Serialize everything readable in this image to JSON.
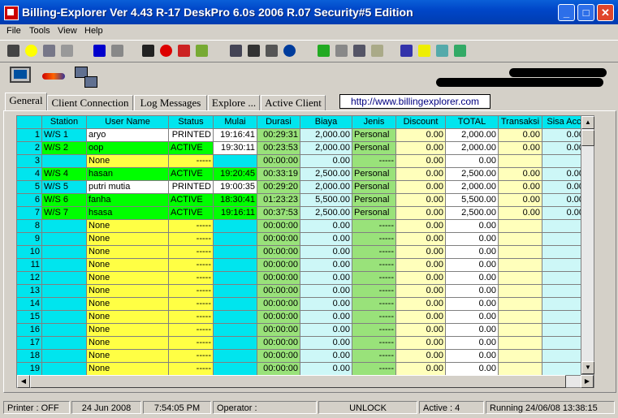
{
  "window": {
    "title": "Billing-Explorer Ver 4.43 R-17 DeskPro 6.0s 2006 R.07 Security#5 Edition"
  },
  "menu": [
    "File",
    "Tools",
    "View",
    "Help"
  ],
  "toolbar_icons": [
    "binoculars-icon",
    "smiley-icon",
    "lock-icon",
    "key-icon",
    "monitor-icon",
    "clock-run-icon",
    "eye-icon",
    "stop-icon",
    "timer-icon",
    "hand-icon",
    "network-icon",
    "users-icon",
    "printer-icon",
    "info-icon",
    "connect-icon",
    "plug-icon",
    "document-icon",
    "notepad-icon",
    "login-icon",
    "flash-icon",
    "database-icon",
    "refresh-icon"
  ],
  "icon_row": [
    "computer-icon",
    "car-icon",
    "network-computers-icon"
  ],
  "tabs": [
    "General",
    "Client Connection",
    "Log Messages",
    "Explore ...",
    "Active Client"
  ],
  "url": "http://www.billingexplorer.com",
  "colors": {
    "header": "#00e5ee",
    "rownum": "#00e5ee",
    "station": "#00e5ee",
    "user_active": "#00ff00",
    "user_idle": "#ffff44",
    "status": "#ffff44",
    "mulai": "#00e5ee",
    "durasi": "#99e27a",
    "biaya": "#cdf7f7",
    "jenis": "#99e27a",
    "discount": "#ffffbb",
    "total": "#ffffff",
    "transaksi": "#ffffbb",
    "sisa": "#cdf7f7"
  },
  "table": {
    "columns": [
      "",
      "Station",
      "User Name",
      "Status",
      "Mulai",
      "Durasi",
      "Biaya",
      "Jenis",
      "Discount",
      "TOTAL",
      "Transaksi",
      "Sisa Acc"
    ],
    "rows": [
      {
        "n": "1",
        "station": "W/S 1",
        "user": "aryo",
        "status": "PRINTED",
        "mulai": "19:16:41",
        "durasi": "00:29:31",
        "biaya": "2,000.00",
        "jenis": "Personal",
        "discount": "0.00",
        "total": "2,000.00",
        "transaksi": "0.00",
        "sisa": "0.00",
        "state": "printed"
      },
      {
        "n": "2",
        "station": "W/S 2",
        "user": "oop",
        "status": "ACTIVE",
        "mulai": "19:30:11",
        "durasi": "00:23:53",
        "biaya": "2,000.00",
        "jenis": "Personal",
        "discount": "0.00",
        "total": "2,000.00",
        "transaksi": "0.00",
        "sisa": "0.00",
        "state": "active2"
      },
      {
        "n": "3",
        "station": "",
        "user": "None",
        "status": "-----",
        "mulai": "",
        "durasi": "00:00:00",
        "biaya": "0.00",
        "jenis": "-----",
        "discount": "0.00",
        "total": "0.00",
        "transaksi": "",
        "sisa": "",
        "state": "none"
      },
      {
        "n": "4",
        "station": "W/S 4",
        "user": "hasan",
        "status": "ACTIVE",
        "mulai": "19:20:45",
        "durasi": "00:33:19",
        "biaya": "2,500.00",
        "jenis": "Personal",
        "discount": "0.00",
        "total": "2,500.00",
        "transaksi": "0.00",
        "sisa": "0.00",
        "state": "active"
      },
      {
        "n": "5",
        "station": "W/S 5",
        "user": "putri mutia",
        "status": "PRINTED",
        "mulai": "19:00:35",
        "durasi": "00:29:20",
        "biaya": "2,000.00",
        "jenis": "Personal",
        "discount": "0.00",
        "total": "2,000.00",
        "transaksi": "0.00",
        "sisa": "0.00",
        "state": "printed"
      },
      {
        "n": "6",
        "station": "W/S 6",
        "user": "fanha",
        "status": "ACTIVE",
        "mulai": "18:30:41",
        "durasi": "01:23:23",
        "biaya": "5,500.00",
        "jenis": "Personal",
        "discount": "0.00",
        "total": "5,500.00",
        "transaksi": "0.00",
        "sisa": "0.00",
        "state": "active"
      },
      {
        "n": "7",
        "station": "W/S 7",
        "user": "hsasa",
        "status": "ACTIVE",
        "mulai": "19:16:11",
        "durasi": "00:37:53",
        "biaya": "2,500.00",
        "jenis": "Personal",
        "discount": "0.00",
        "total": "2,500.00",
        "transaksi": "0.00",
        "sisa": "0.00",
        "state": "active"
      },
      {
        "n": "8",
        "station": "",
        "user": "None",
        "status": "-----",
        "mulai": "",
        "durasi": "00:00:00",
        "biaya": "0.00",
        "jenis": "-----",
        "discount": "0.00",
        "total": "0.00",
        "transaksi": "",
        "sisa": "",
        "state": "none"
      },
      {
        "n": "9",
        "station": "",
        "user": "None",
        "status": "-----",
        "mulai": "",
        "durasi": "00:00:00",
        "biaya": "0.00",
        "jenis": "-----",
        "discount": "0.00",
        "total": "0.00",
        "transaksi": "",
        "sisa": "",
        "state": "none"
      },
      {
        "n": "10",
        "station": "",
        "user": "None",
        "status": "-----",
        "mulai": "",
        "durasi": "00:00:00",
        "biaya": "0.00",
        "jenis": "-----",
        "discount": "0.00",
        "total": "0.00",
        "transaksi": "",
        "sisa": "",
        "state": "none"
      },
      {
        "n": "11",
        "station": "",
        "user": "None",
        "status": "-----",
        "mulai": "",
        "durasi": "00:00:00",
        "biaya": "0.00",
        "jenis": "-----",
        "discount": "0.00",
        "total": "0.00",
        "transaksi": "",
        "sisa": "",
        "state": "none"
      },
      {
        "n": "12",
        "station": "",
        "user": "None",
        "status": "-----",
        "mulai": "",
        "durasi": "00:00:00",
        "biaya": "0.00",
        "jenis": "-----",
        "discount": "0.00",
        "total": "0.00",
        "transaksi": "",
        "sisa": "",
        "state": "none"
      },
      {
        "n": "13",
        "station": "",
        "user": "None",
        "status": "-----",
        "mulai": "",
        "durasi": "00:00:00",
        "biaya": "0.00",
        "jenis": "-----",
        "discount": "0.00",
        "total": "0.00",
        "transaksi": "",
        "sisa": "",
        "state": "none"
      },
      {
        "n": "14",
        "station": "",
        "user": "None",
        "status": "-----",
        "mulai": "",
        "durasi": "00:00:00",
        "biaya": "0.00",
        "jenis": "-----",
        "discount": "0.00",
        "total": "0.00",
        "transaksi": "",
        "sisa": "",
        "state": "none"
      },
      {
        "n": "15",
        "station": "",
        "user": "None",
        "status": "-----",
        "mulai": "",
        "durasi": "00:00:00",
        "biaya": "0.00",
        "jenis": "-----",
        "discount": "0.00",
        "total": "0.00",
        "transaksi": "",
        "sisa": "",
        "state": "none"
      },
      {
        "n": "16",
        "station": "",
        "user": "None",
        "status": "-----",
        "mulai": "",
        "durasi": "00:00:00",
        "biaya": "0.00",
        "jenis": "-----",
        "discount": "0.00",
        "total": "0.00",
        "transaksi": "",
        "sisa": "",
        "state": "none"
      },
      {
        "n": "17",
        "station": "",
        "user": "None",
        "status": "-----",
        "mulai": "",
        "durasi": "00:00:00",
        "biaya": "0.00",
        "jenis": "-----",
        "discount": "0.00",
        "total": "0.00",
        "transaksi": "",
        "sisa": "",
        "state": "none"
      },
      {
        "n": "18",
        "station": "",
        "user": "None",
        "status": "-----",
        "mulai": "",
        "durasi": "00:00:00",
        "biaya": "0.00",
        "jenis": "-----",
        "discount": "0.00",
        "total": "0.00",
        "transaksi": "",
        "sisa": "",
        "state": "none"
      },
      {
        "n": "19",
        "station": "",
        "user": "None",
        "status": "-----",
        "mulai": "",
        "durasi": "00:00:00",
        "biaya": "0.00",
        "jenis": "-----",
        "discount": "0.00",
        "total": "0.00",
        "transaksi": "",
        "sisa": "",
        "state": "none"
      }
    ]
  },
  "status": {
    "printer": "Printer : OFF",
    "date": "24 Jun 2008",
    "time": "7:54:05 PM",
    "operator": "Operator :",
    "lock": "UNLOCK",
    "active": "Active :  4",
    "running": "Running 24/06/08  13:38:15"
  }
}
